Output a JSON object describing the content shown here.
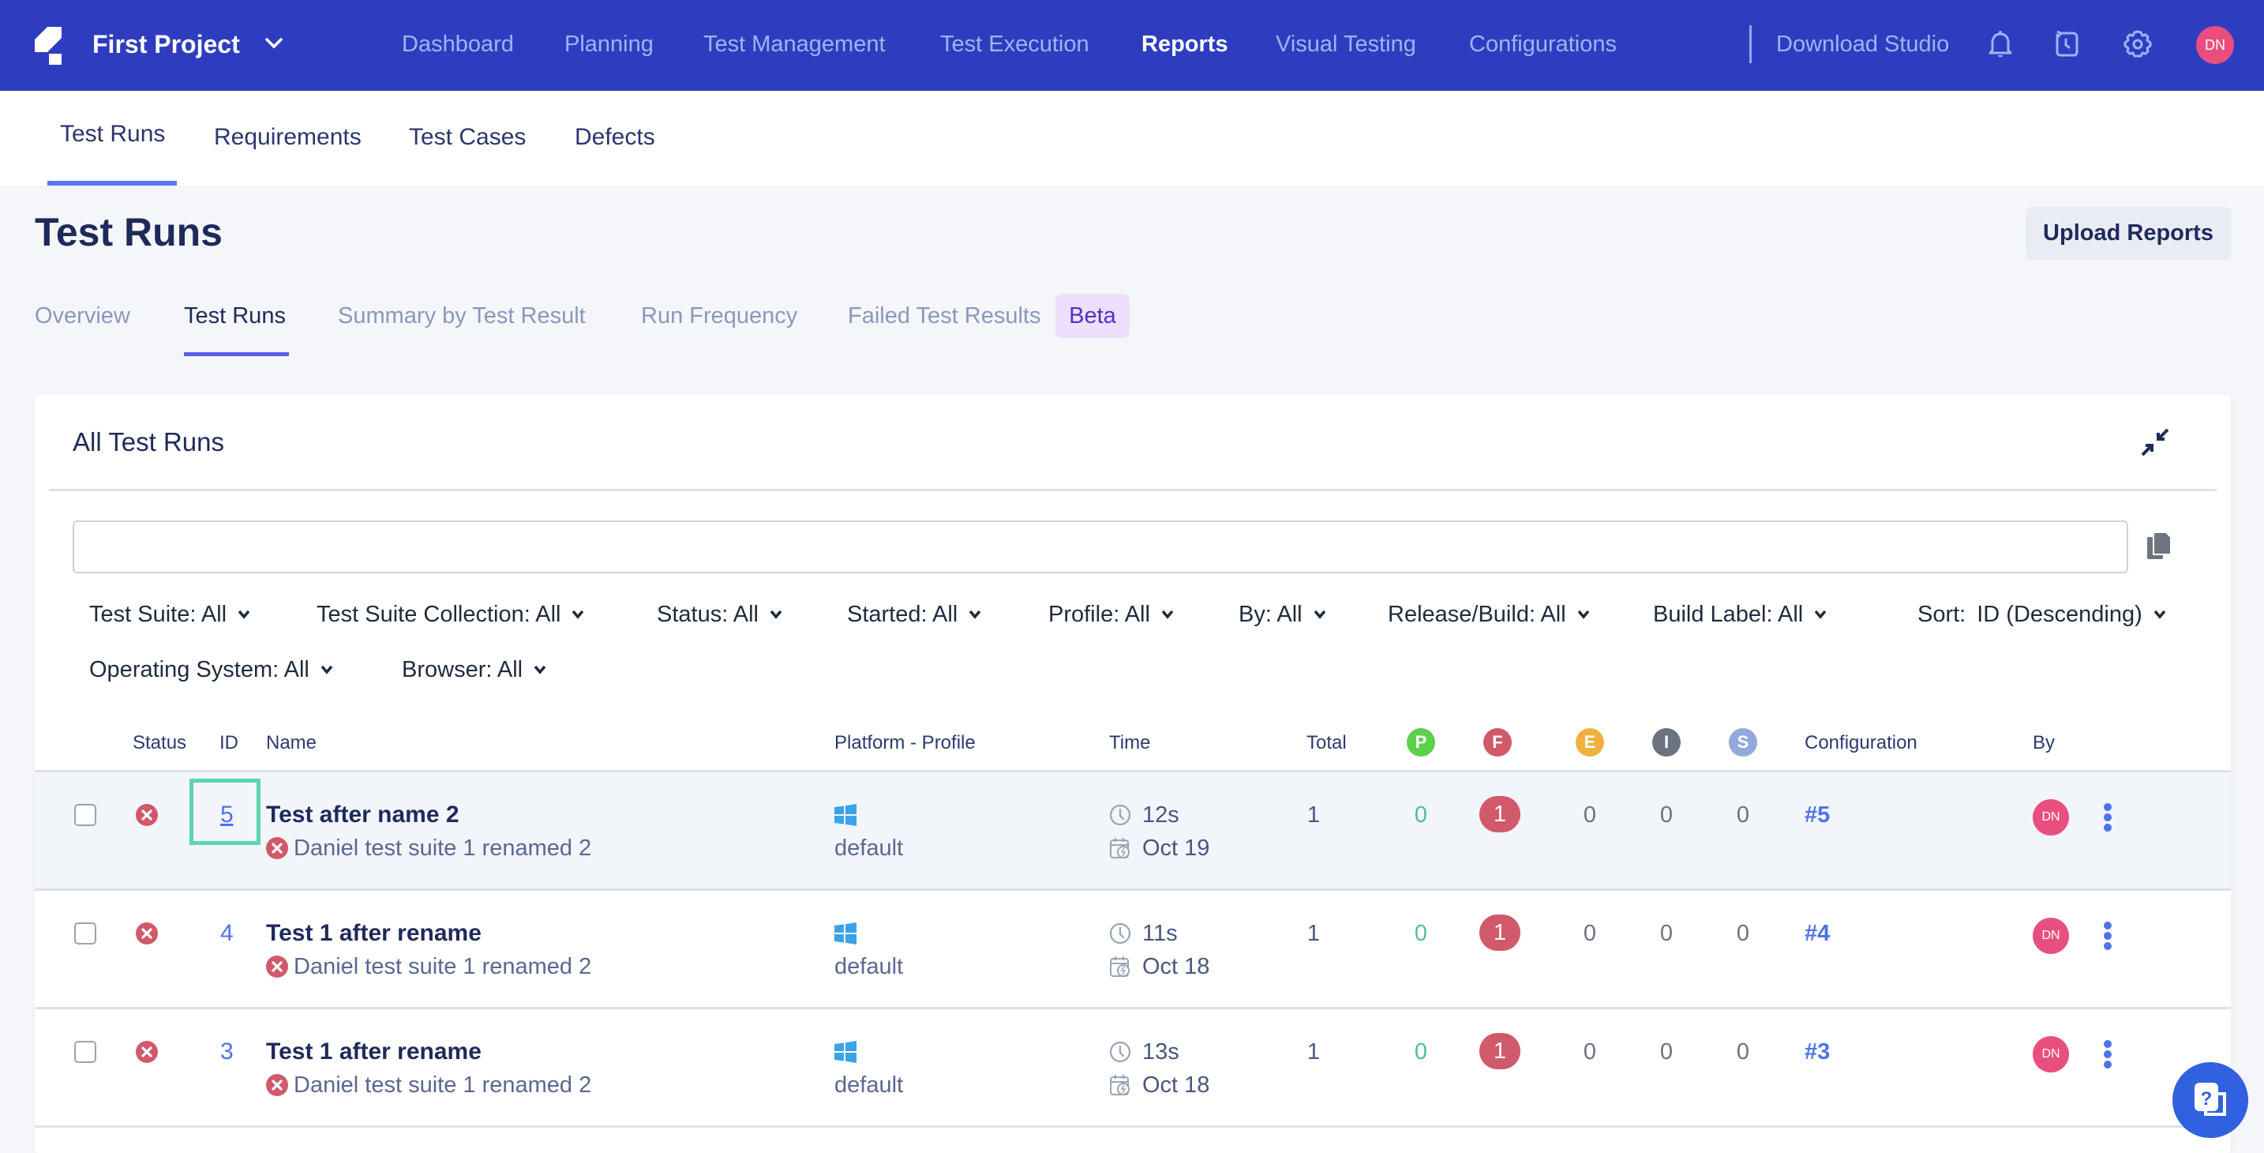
{
  "topnav": {
    "project": "First Project",
    "links": [
      "Dashboard",
      "Planning",
      "Test Management",
      "Test Execution",
      "Reports",
      "Visual Testing",
      "Configurations"
    ],
    "active": "Reports",
    "download": "Download Studio",
    "user_initials": "DN"
  },
  "subnav": {
    "tabs": [
      "Test Runs",
      "Requirements",
      "Test Cases",
      "Defects"
    ],
    "active": "Test Runs"
  },
  "page": {
    "title": "Test Runs",
    "upload_label": "Upload Reports",
    "tabs": [
      "Overview",
      "Test Runs",
      "Summary by Test Result",
      "Run Frequency",
      "Failed Test Results"
    ],
    "active_tab": "Test Runs",
    "beta_label": "Beta"
  },
  "card": {
    "title": "All Test Runs",
    "search_value": "",
    "search_placeholder": "",
    "filters": [
      "Test Suite: All",
      "Test Suite Collection: All",
      "Status: All",
      "Started: All",
      "Profile: All",
      "By: All",
      "Release/Build: All",
      "Build Label: All"
    ],
    "filters_row2": [
      "Operating System: All",
      "Browser: All"
    ],
    "sort_label": "Sort:",
    "sort_value": "ID (Descending)"
  },
  "table": {
    "headers": {
      "status": "Status",
      "id": "ID",
      "name": "Name",
      "platform": "Platform - Profile",
      "time": "Time",
      "total": "Total",
      "passed": "P",
      "failed": "F",
      "error": "E",
      "incomplete": "I",
      "skipped": "S",
      "configuration": "Configuration",
      "by": "By"
    },
    "status_colors": {
      "passed": "#5DD04C",
      "failed": "#D0596A",
      "error": "#F0B03E",
      "incomplete": "#6B7280",
      "skipped": "#93A9DE"
    },
    "rows": [
      {
        "id": "5",
        "name": "Test after name 2",
        "suite": "Daniel test suite 1 renamed 2",
        "status": "failed",
        "platform_icon": "windows-icon",
        "profile": "default",
        "duration": "12s",
        "date": "Oct 19",
        "total": "1",
        "passed": "0",
        "failed": "1",
        "error": "0",
        "incomplete": "0",
        "skipped": "0",
        "configuration": "#5",
        "by": "DN",
        "highlighted": true
      },
      {
        "id": "4",
        "name": "Test 1 after rename",
        "suite": "Daniel test suite 1 renamed 2",
        "status": "failed",
        "platform_icon": "windows-icon",
        "profile": "default",
        "duration": "11s",
        "date": "Oct 18",
        "total": "1",
        "passed": "0",
        "failed": "1",
        "error": "0",
        "incomplete": "0",
        "skipped": "0",
        "configuration": "#4",
        "by": "DN",
        "highlighted": false
      },
      {
        "id": "3",
        "name": "Test 1 after rename",
        "suite": "Daniel test suite 1 renamed 2",
        "status": "failed",
        "platform_icon": "windows-icon",
        "profile": "default",
        "duration": "13s",
        "date": "Oct 18",
        "total": "1",
        "passed": "0",
        "failed": "1",
        "error": "0",
        "incomplete": "0",
        "skipped": "0",
        "configuration": "#3",
        "by": "DN",
        "highlighted": false
      }
    ]
  }
}
